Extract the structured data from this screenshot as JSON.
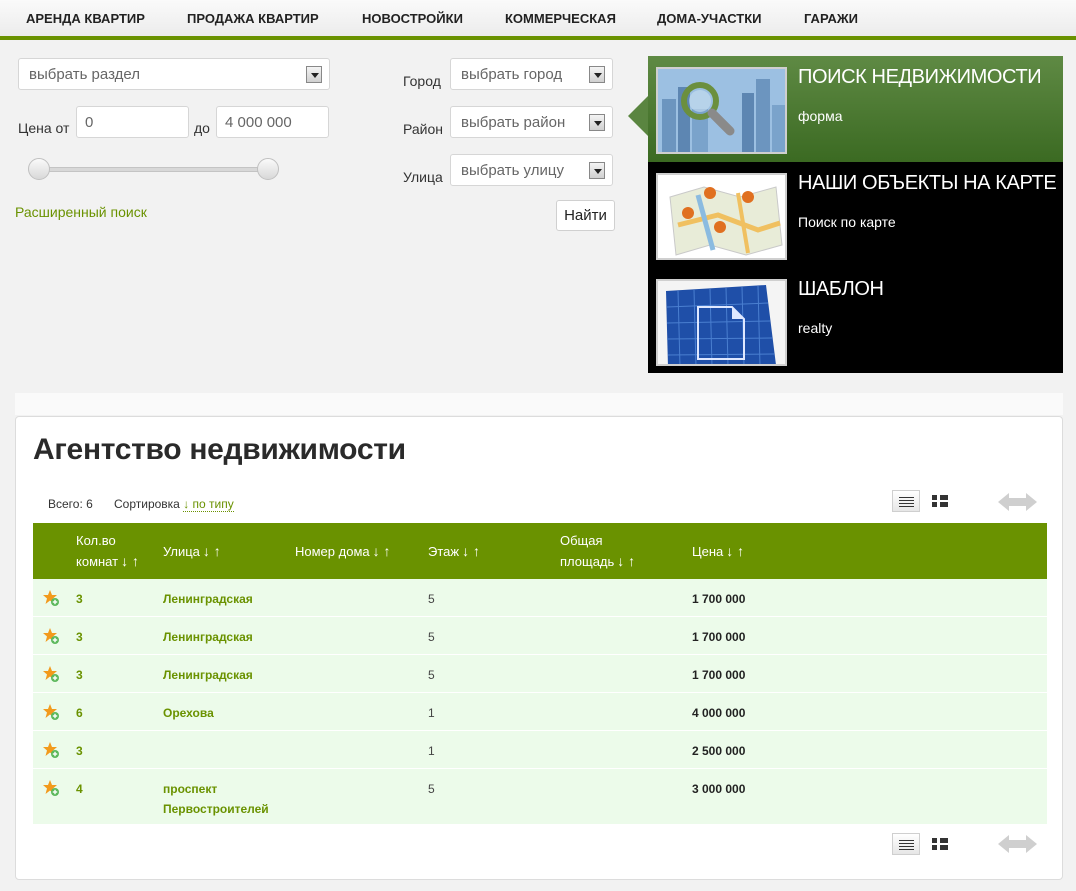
{
  "nav": {
    "items": [
      {
        "label": "АРЕНДА КВАРТИР"
      },
      {
        "label": "ПРОДАЖА КВАРТИР"
      },
      {
        "label": "НОВОСТРОЙКИ"
      },
      {
        "label": "КОММЕРЧЕСКАЯ"
      },
      {
        "label": "ДОМА-УЧАСТКИ"
      },
      {
        "label": "ГАРАЖИ"
      }
    ]
  },
  "search": {
    "section_select": "выбрать раздел",
    "price_from_label": "Цена от",
    "price_from_value": "0",
    "price_to_label": "до",
    "price_to_value": "4 000 000",
    "price_range_min": 0,
    "price_range_max": 4000000,
    "advanced_link": "Расширенный поиск",
    "city_label": "Город",
    "city_select": "выбрать город",
    "district_label": "Район",
    "district_select": "выбрать район",
    "street_label": "Улица",
    "street_select": "выбрать улицу",
    "find_button": "Найти"
  },
  "promo": {
    "items": [
      {
        "title": "ПОИСК НЕДВИЖИМОСТИ",
        "subtitle": "форма",
        "icon": "search-city-icon"
      },
      {
        "title": "НАШИ ОБЪЕКТЫ НА КАРТЕ",
        "subtitle": "Поиск по карте",
        "icon": "map-pins-icon"
      },
      {
        "title": "ШАБЛОН",
        "subtitle": "realty",
        "icon": "blueprint-icon"
      }
    ]
  },
  "main": {
    "title": "Агентство недвижимости",
    "total_label": "Всего: 6",
    "sort_label": "Сортировка",
    "sort_link": "↓ по типу",
    "columns": [
      {
        "label_line1": "Кол.во",
        "label_line2": "комнат",
        "sort": "↓ ↑"
      },
      {
        "label_line1": "Улица",
        "label_line2": "",
        "sort": "↓ ↑"
      },
      {
        "label_line1": "Номер дома",
        "label_line2": "",
        "sort": "↓ ↑"
      },
      {
        "label_line1": "Этаж",
        "label_line2": "",
        "sort": "↓ ↑"
      },
      {
        "label_line1": "Общая",
        "label_line2": "площадь",
        "sort": "↓ ↑"
      },
      {
        "label_line1": "Цена",
        "label_line2": "",
        "sort": "↓ ↑"
      }
    ],
    "rows": [
      {
        "rooms": "3",
        "street_line1": "Ленинградская",
        "street_line2": "",
        "floor": "5",
        "price": "1 700 000"
      },
      {
        "rooms": "3",
        "street_line1": "Ленинградская",
        "street_line2": "",
        "floor": "5",
        "price": "1 700 000"
      },
      {
        "rooms": "3",
        "street_line1": "Ленинградская",
        "street_line2": "",
        "floor": "5",
        "price": "1 700 000"
      },
      {
        "rooms": "6",
        "street_line1": "Орехова",
        "street_line2": "",
        "floor": "1",
        "price": "4 000 000"
      },
      {
        "rooms": "3",
        "street_line1": "",
        "street_line2": "",
        "floor": "1",
        "price": "2 500 000"
      },
      {
        "rooms": "4",
        "street_line1": "проспект",
        "street_line2": "Первостроителей",
        "floor": "5",
        "price": "3 000 000"
      }
    ]
  },
  "colors": {
    "accent": "#6a9200",
    "row_bg": "#ecfbea",
    "promo_active": "#4e7a33"
  }
}
